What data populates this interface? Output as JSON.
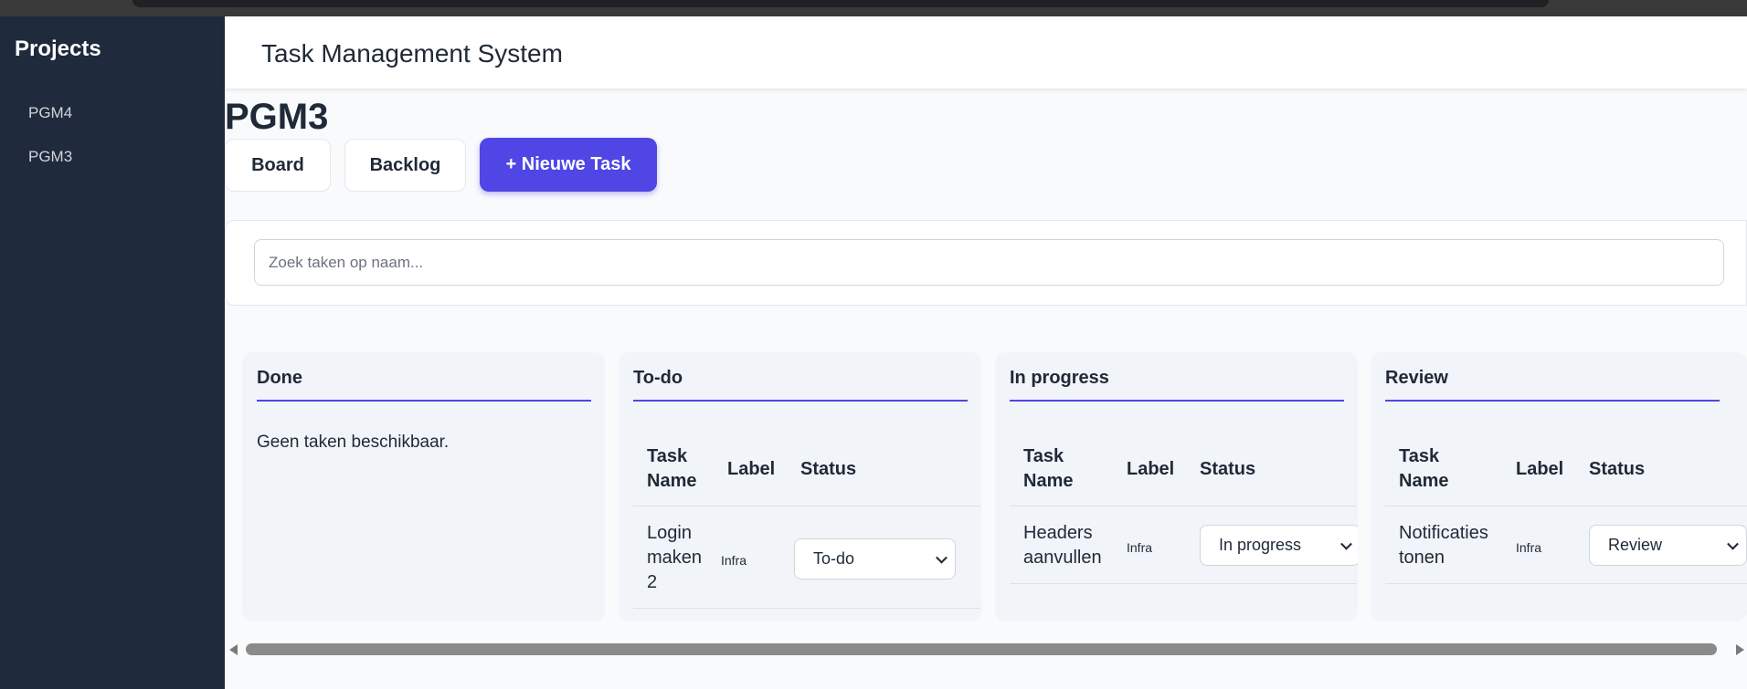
{
  "sidebar": {
    "title": "Projects",
    "items": [
      {
        "label": "PGM4"
      },
      {
        "label": "PGM3"
      }
    ]
  },
  "header": {
    "title": "Task Management System"
  },
  "project": {
    "title": "PGM3"
  },
  "toolbar": {
    "board_label": "Board",
    "backlog_label": "Backlog",
    "new_task_label": "+ Nieuwe Task"
  },
  "search": {
    "placeholder": "Zoek taken op naam...",
    "value": ""
  },
  "table_headers": {
    "task_name": "Task Name",
    "label": "Label",
    "status": "Status"
  },
  "columns": [
    {
      "title": "Done",
      "empty_text": "Geen taken beschikbaar.",
      "tasks": []
    },
    {
      "title": "To-do",
      "tasks": [
        {
          "name": "Login maken 2",
          "label": "Infra",
          "status": "To-do"
        }
      ]
    },
    {
      "title": "In progress",
      "tasks": [
        {
          "name": "Headers aanvullen",
          "label": "Infra",
          "status": "In progress"
        }
      ]
    },
    {
      "title": "Review",
      "tasks": [
        {
          "name": "Notificaties tonen",
          "label": "Infra",
          "status": "Review"
        }
      ]
    }
  ],
  "colors": {
    "accent": "#4f46e5",
    "sidebar_bg": "#1f2a3c",
    "column_bg": "#f1f4f8"
  }
}
